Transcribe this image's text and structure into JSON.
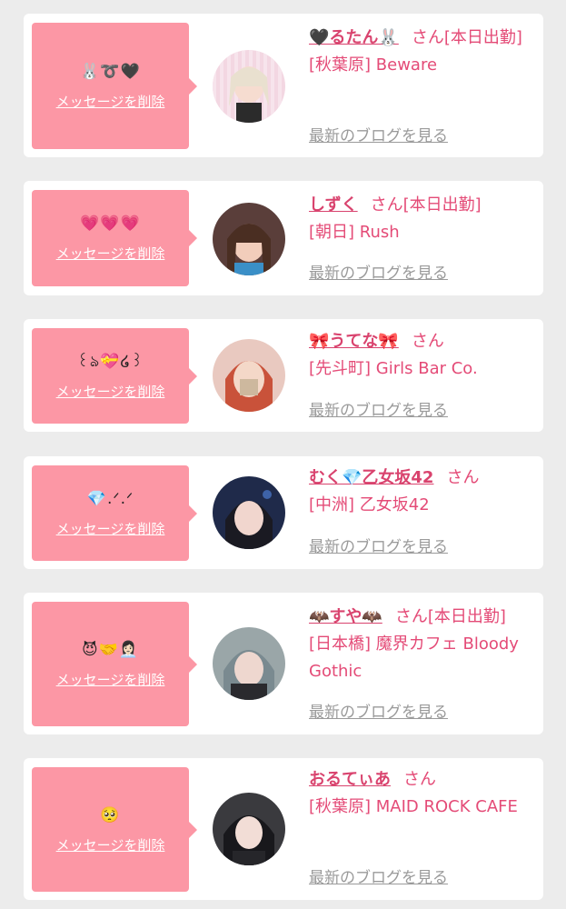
{
  "common": {
    "delete_label": "メッセージを削除",
    "blog_label": "最新のブログを見る"
  },
  "colors": {
    "bubble": "#fc97a5",
    "accent": "#e44b77",
    "muted": "#9a9a9a",
    "background": "#ececec"
  },
  "cards": [
    {
      "message": "🐰➰🖤",
      "name": "🖤るたん🐰",
      "san": "さん",
      "tag": "[本日出勤]",
      "store": "[秋葉原] Beware"
    },
    {
      "message": "💗💗💗",
      "name": "しずく",
      "san": "さん",
      "tag": "[本日出勤]",
      "store": "[朝日] Rush"
    },
    {
      "message": "꒰ঌ💝໒꒱",
      "name": "🎀うてな🎀",
      "san": "さん",
      "tag": "",
      "store": "[先斗町] Girls Bar Co."
    },
    {
      "message": "💎.ᐟ.ᐟ",
      "name": "むく💎乙女坂42",
      "san": "さん",
      "tag": "",
      "store": "[中洲] 乙女坂42"
    },
    {
      "message": "😈🤝👩🏻‍💼",
      "name": "🦇すや🦇",
      "san": "さん",
      "tag": "[本日出勤]",
      "store": "[日本橋] 魔界カフェ Bloody Gothic"
    },
    {
      "message": "🥺",
      "name": "おるてぃあ",
      "san": "さん",
      "tag": "",
      "store": "[秋葉原] MAID ROCK CAFE"
    }
  ]
}
